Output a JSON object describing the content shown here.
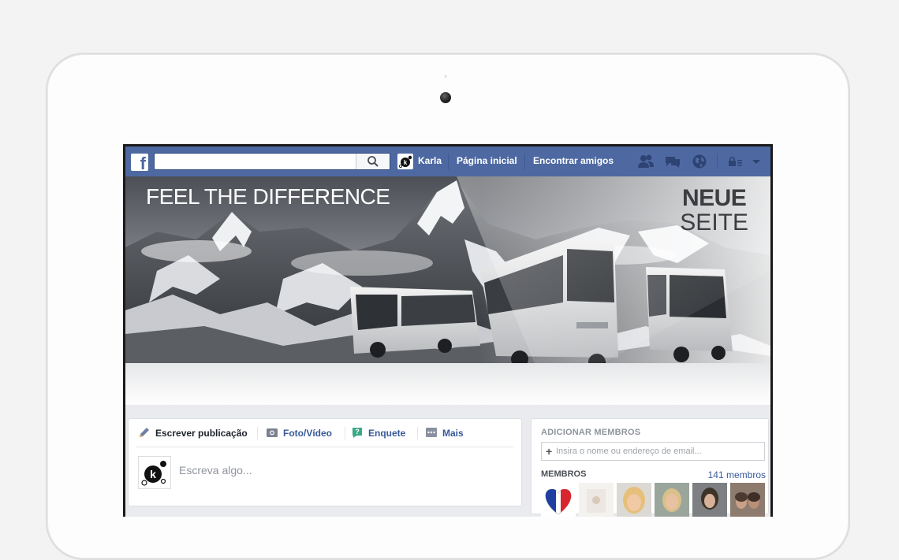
{
  "header": {
    "logo": "f",
    "search_placeholder": "",
    "user_name": "Karla",
    "home_link": "Página inicial",
    "find_friends_link": "Encontrar amigos"
  },
  "cover": {
    "headline_part1": "FEEL ",
    "headline_part2": "THE ",
    "headline_part3": "DIFFERENCE",
    "badge_line1": "NEUE",
    "badge_line2": "SEITE"
  },
  "composer": {
    "tabs": [
      {
        "label": "Escrever publicação",
        "icon": "pencil-icon"
      },
      {
        "label": "Foto/Vídeo",
        "icon": "camera-icon"
      },
      {
        "label": "Enquete",
        "icon": "poll-icon"
      },
      {
        "label": "Mais",
        "icon": "more-icon"
      }
    ],
    "placeholder": "Escreva algo..."
  },
  "members_panel": {
    "add_title": "ADICIONAR MEMBROS",
    "add_placeholder": "Insira o nome ou endereço de email...",
    "members_label": "MEMBROS",
    "members_count": "141 membros"
  },
  "colors": {
    "fb_blue": "#4e69a2",
    "link_blue": "#365899",
    "background": "#e9ebee"
  }
}
